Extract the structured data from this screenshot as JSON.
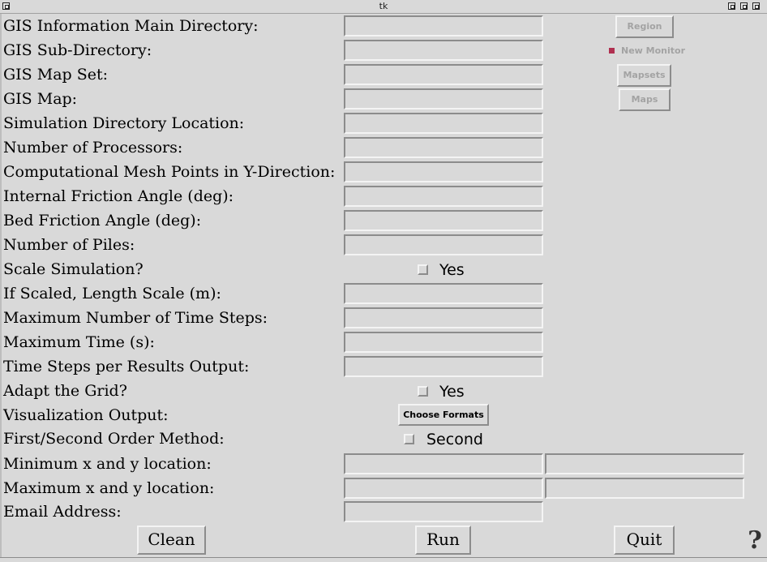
{
  "window": {
    "title": "tk"
  },
  "labels": {
    "gis_main_dir": "GIS Information Main Directory:",
    "gis_sub_dir": "GIS Sub-Directory:",
    "gis_map_set": "GIS Map Set:",
    "gis_map": "GIS Map:",
    "sim_dir": "Simulation Directory Location:",
    "num_procs": "Number of Processors:",
    "mesh_points": "Computational Mesh Points in Y-Direction:",
    "int_friction": "Internal Friction Angle (deg):",
    "bed_friction": "Bed Friction Angle (deg):",
    "num_piles": "Number of Piles:",
    "scale_sim": "Scale Simulation?",
    "length_scale": "If Scaled, Length Scale (m):",
    "max_steps": "Maximum Number of Time Steps:",
    "max_time": "Maximum Time (s):",
    "steps_output": "Time Steps per Results Output:",
    "adapt_grid": "Adapt the Grid?",
    "vis_output": "Visualization Output:",
    "order_method": "First/Second Order Method:",
    "min_xy": "Minimum x and y location:",
    "max_xy": "Maximum x and y location:",
    "email": "Email Address:"
  },
  "fields": {
    "gis_main_dir": "",
    "gis_sub_dir": "",
    "gis_map_set": "",
    "gis_map": "",
    "sim_dir": "",
    "num_procs": "",
    "mesh_points": "",
    "int_friction": "",
    "bed_friction": "",
    "num_piles": "",
    "length_scale": "",
    "max_steps": "",
    "max_time": "",
    "steps_output": "",
    "min_x": "",
    "min_y": "",
    "max_x": "",
    "max_y": "",
    "email": ""
  },
  "checkboxes": {
    "scale_yes": "Yes",
    "adapt_yes": "Yes",
    "second_order": "Second",
    "new_monitor": "New Monitor"
  },
  "side_buttons": {
    "region": "Region",
    "mapsets": "Mapsets",
    "maps": "Maps"
  },
  "buttons": {
    "choose_formats": "Choose Formats",
    "clean": "Clean",
    "run": "Run",
    "quit": "Quit",
    "help": "?"
  }
}
